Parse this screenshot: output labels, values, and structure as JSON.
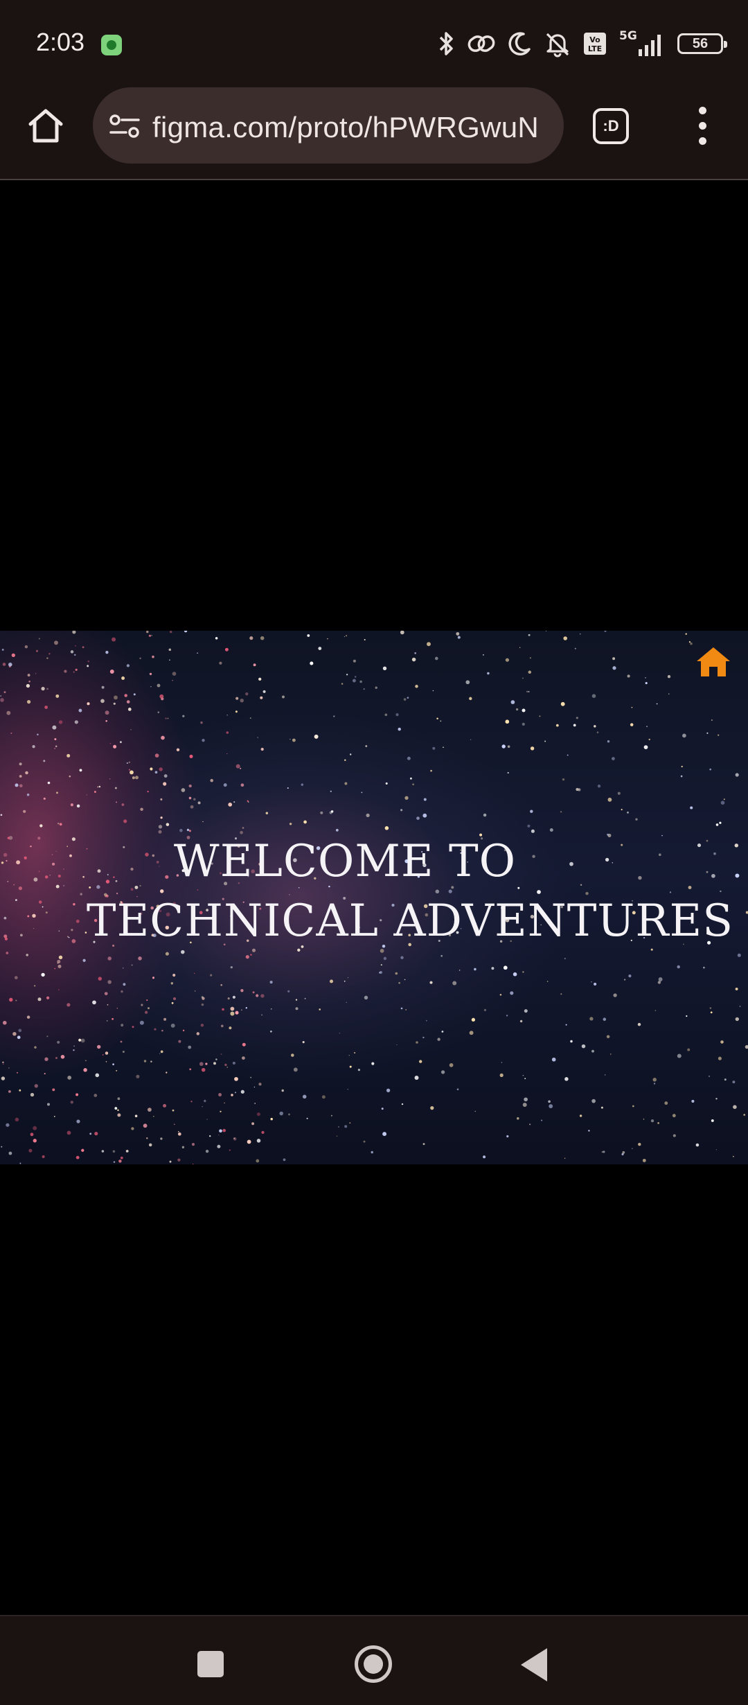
{
  "status_bar": {
    "time": "2:03",
    "network": "5G",
    "volte": "Vo LTE",
    "battery_level": "56",
    "icons": [
      "whatsapp-icon",
      "bluetooth-icon",
      "link-icon",
      "moon-icon",
      "silent-icon",
      "volte-icon",
      "signal-icon",
      "battery-icon"
    ]
  },
  "browser": {
    "url": "figma.com/proto/hPWRGwuN",
    "tab_label": ":D",
    "icons": [
      "home-icon",
      "tune-icon",
      "tab-switcher-icon",
      "more-vertical-icon"
    ]
  },
  "hero": {
    "line1": "WELCOME TO",
    "line2": "TECHNICAL ADVENTURES",
    "home_icon_color": "#f08a12"
  },
  "nav_bar": {
    "buttons": [
      "recents-button",
      "home-button",
      "back-button"
    ]
  },
  "colors": {
    "chrome_bg": "#1b1212",
    "url_pill_bg": "#3a2d2b",
    "page_bg": "#000000",
    "accent_orange": "#f08a12"
  }
}
